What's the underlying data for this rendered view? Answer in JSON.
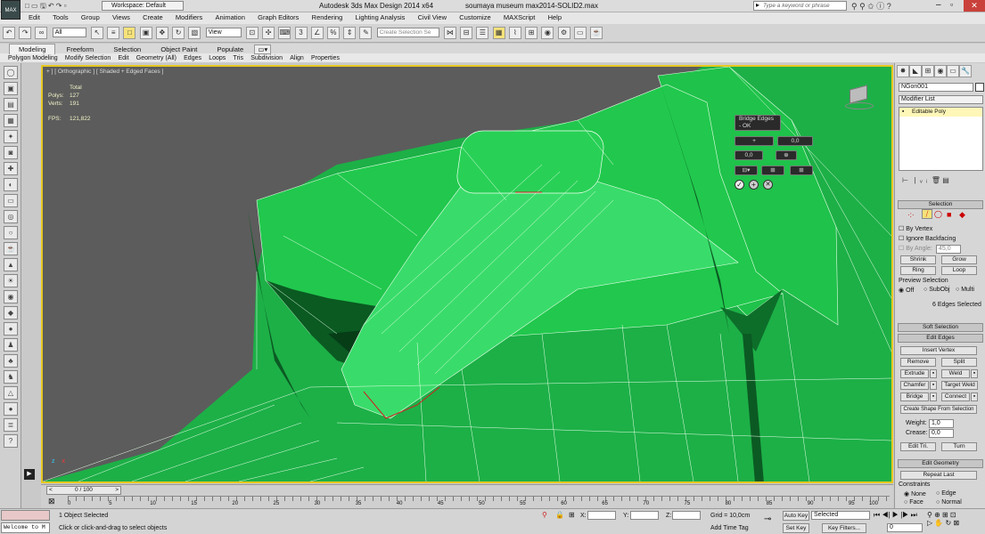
{
  "titlebar": {
    "app_title": "Autodesk 3ds Max Design 2014 x64",
    "file_title": "soumaya museum max2014-SOLID2.max",
    "workspace": "Workspace: Default",
    "search_placeholder": "Type a keyword or phrase"
  },
  "menu": [
    "Edit",
    "Tools",
    "Group",
    "Views",
    "Create",
    "Modifiers",
    "Animation",
    "Graph Editors",
    "Rendering",
    "Lighting Analysis",
    "Civil View",
    "Customize",
    "MAXScript",
    "Help"
  ],
  "toolbar": {
    "filter_value": "All",
    "refcoord_value": "View",
    "selection_set_placeholder": "Create Selection Se"
  },
  "ribbon": {
    "tabs": [
      "Modeling",
      "Freeform",
      "Selection",
      "Object Paint",
      "Populate"
    ],
    "subtabs": [
      "Polygon Modeling",
      "Modify Selection",
      "Edit",
      "Geometry (All)",
      "Edges",
      "Loops",
      "Tris",
      "Subdivision",
      "Align",
      "Properties"
    ]
  },
  "viewport": {
    "label_a": "+ ] [ Orthographic ]",
    "label_b": "[ Shaded + Edged Faces ]",
    "stats_total": "Total",
    "stats_polys_label": "Polys:",
    "stats_polys": "127",
    "stats_verts_label": "Verts:",
    "stats_verts": "191",
    "fps_label": "FPS:",
    "fps": "121,822"
  },
  "caddy": {
    "title": "Bridge Edges",
    "sub": "- OK",
    "seg_value": "0,0",
    "taper_value": "0,0",
    "plus": "+"
  },
  "cmdpanel": {
    "object_name": "NGon001",
    "modifier_list": "Modifier List",
    "stack_item": "Editable Poly",
    "selection_header": "Selection",
    "by_vertex": "By Vertex",
    "ignore_backfacing": "Ignore Backfacing",
    "by_angle": "By Angle:",
    "by_angle_value": "45,0",
    "shrink": "Shrink",
    "grow": "Grow",
    "ring": "Ring",
    "loop": "Loop",
    "preview_selection": "Preview Selection",
    "preview_off": "Off",
    "preview_subobj": "SubObj",
    "preview_multi": "Multi",
    "edges_selected": "6 Edges Selected",
    "soft_selection": "Soft Selection",
    "edit_edges": "Edit Edges",
    "insert_vertex": "Insert Vertex",
    "remove": "Remove",
    "split": "Split",
    "extrude": "Extrude",
    "weld": "Weld",
    "chamfer": "Chamfer",
    "target_weld": "Target Weld",
    "bridge": "Bridge",
    "connect": "Connect",
    "create_shape": "Create Shape From Selection",
    "weight_label": "Weight:",
    "weight_value": "1,0",
    "crease_label": "Crease:",
    "crease_value": "0,0",
    "edit_tri": "Edit Tri.",
    "turn": "Turn",
    "edit_geometry": "Edit Geometry",
    "repeat_last": "Repeat Last",
    "constraints": "Constraints",
    "c_none": "None",
    "c_edge": "Edge",
    "c_face": "Face",
    "c_normal": "Normal"
  },
  "timeline": {
    "frame": "0 / 100",
    "ticks": [
      "0",
      "5",
      "10",
      "15",
      "20",
      "25",
      "30",
      "35",
      "40",
      "45",
      "50",
      "55",
      "60",
      "65",
      "70",
      "75",
      "80",
      "85",
      "90",
      "95",
      "100"
    ]
  },
  "status": {
    "welcome": "Welcome to M",
    "selected": "1 Object Selected",
    "prompt": "Click or click-and-drag to select objects",
    "x_label": "X:",
    "y_label": "Y:",
    "z_label": "Z:",
    "grid": "Grid = 10,0cm",
    "add_time_tag": "Add Time Tag",
    "auto_key": "Auto Key",
    "auto_key_value": "Selected",
    "set_key": "Set Key",
    "key_filters": "Key Filters...",
    "frame_field": "0"
  },
  "colors": {
    "mesh_green": "#1fc24a",
    "mesh_dark": "#0d6e2a",
    "viewport_bg": "#5c5c5c",
    "viewport_border": "#e6c820"
  }
}
